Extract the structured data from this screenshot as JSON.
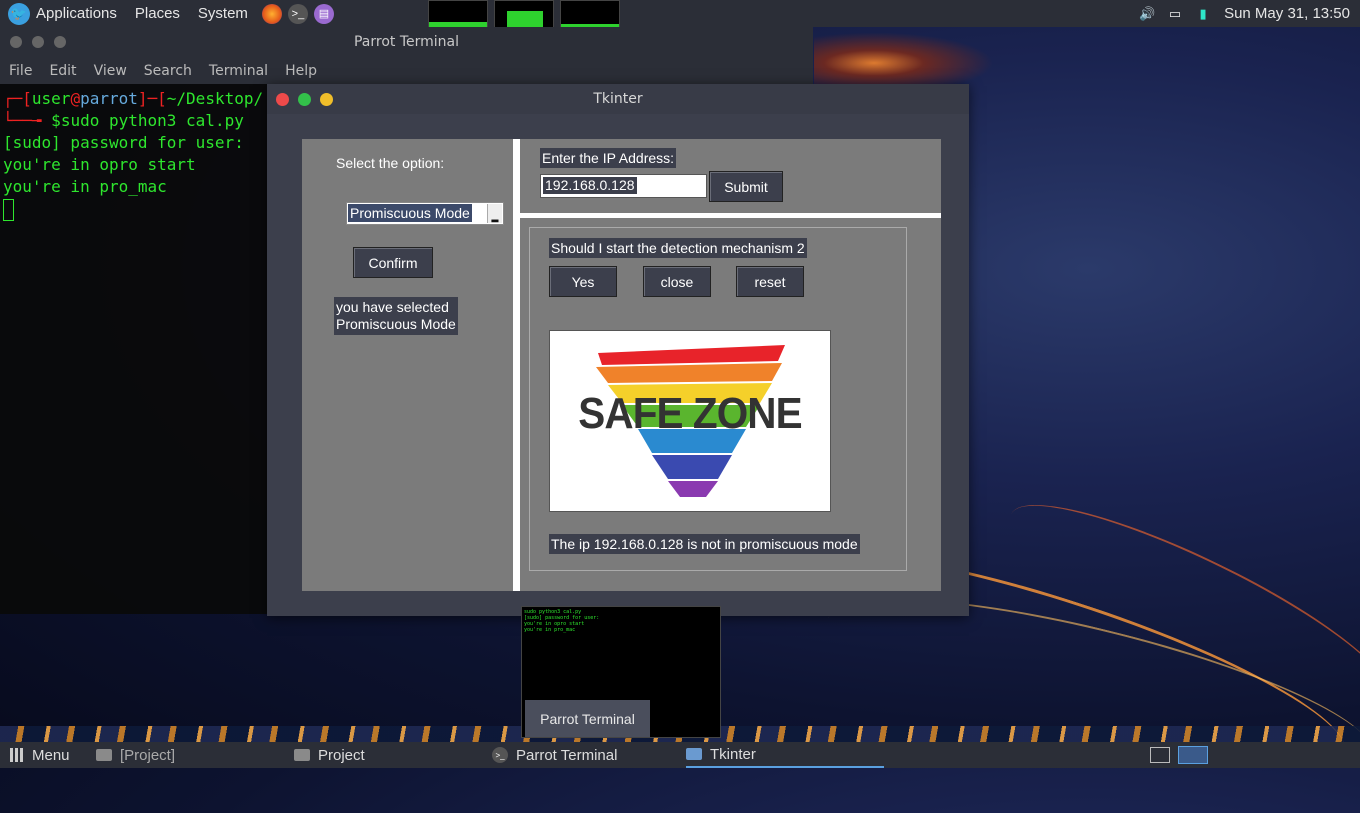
{
  "top_panel": {
    "applications": "Applications",
    "places": "Places",
    "system": "System",
    "datetime": "Sun May 31, 13:50"
  },
  "terminal": {
    "title": "Parrot Terminal",
    "menu": [
      "File",
      "Edit",
      "View",
      "Search",
      "Terminal",
      "Help"
    ],
    "prompt_user": "user",
    "prompt_at": "@",
    "prompt_host": "parrot",
    "prompt_path": "~/Desktop/",
    "command": "sudo python3 cal.py",
    "lines": [
      "[sudo] password for user:",
      "you're in opro start",
      "you're in pro_mac"
    ]
  },
  "tk": {
    "title": "Tkinter",
    "select_label": "Select the option:",
    "combo_value": "Promiscuous Mode",
    "confirm": "Confirm",
    "selected_line1": "you have selected",
    "selected_line2": "Promiscuous Mode",
    "ip_label": "Enter the IP Address:",
    "ip_value": "192.168.0.128",
    "submit": "Submit",
    "question": "Should I start the detection mechanism 2",
    "yes": "Yes",
    "close": "close",
    "reset": "reset",
    "image_text": "SAFE ZONE",
    "result": "The ip 192.168.0.128 is not in promiscuous mode"
  },
  "taskbar": {
    "menu": "Menu",
    "items": [
      "[Project]",
      "Project",
      "Parrot Terminal",
      "Tkinter"
    ],
    "preview_label": "Parrot Terminal"
  },
  "colors": {
    "accent": "#5aa0e0",
    "terminal_text": "#2ee62e",
    "prompt_red": "#ee2222"
  }
}
